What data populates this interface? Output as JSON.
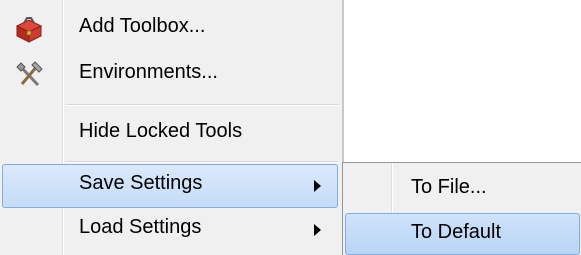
{
  "menu": {
    "items": [
      {
        "label": "Add Toolbox...",
        "icon": "toolbox-icon"
      },
      {
        "label": "Environments...",
        "icon": "hammer-wrench-icon"
      },
      {
        "label": "Hide Locked Tools"
      },
      {
        "label": "Save Settings",
        "has_submenu": true,
        "highlighted": true
      },
      {
        "label": "Load Settings",
        "has_submenu": true
      }
    ]
  },
  "submenu": {
    "items": [
      {
        "label": "To File..."
      },
      {
        "label": "To Default",
        "highlighted": true
      }
    ]
  },
  "colors": {
    "menu_bg": "#f0f0f0",
    "highlight_bg": "#c5dcf7",
    "highlight_border": "#84acdd"
  }
}
